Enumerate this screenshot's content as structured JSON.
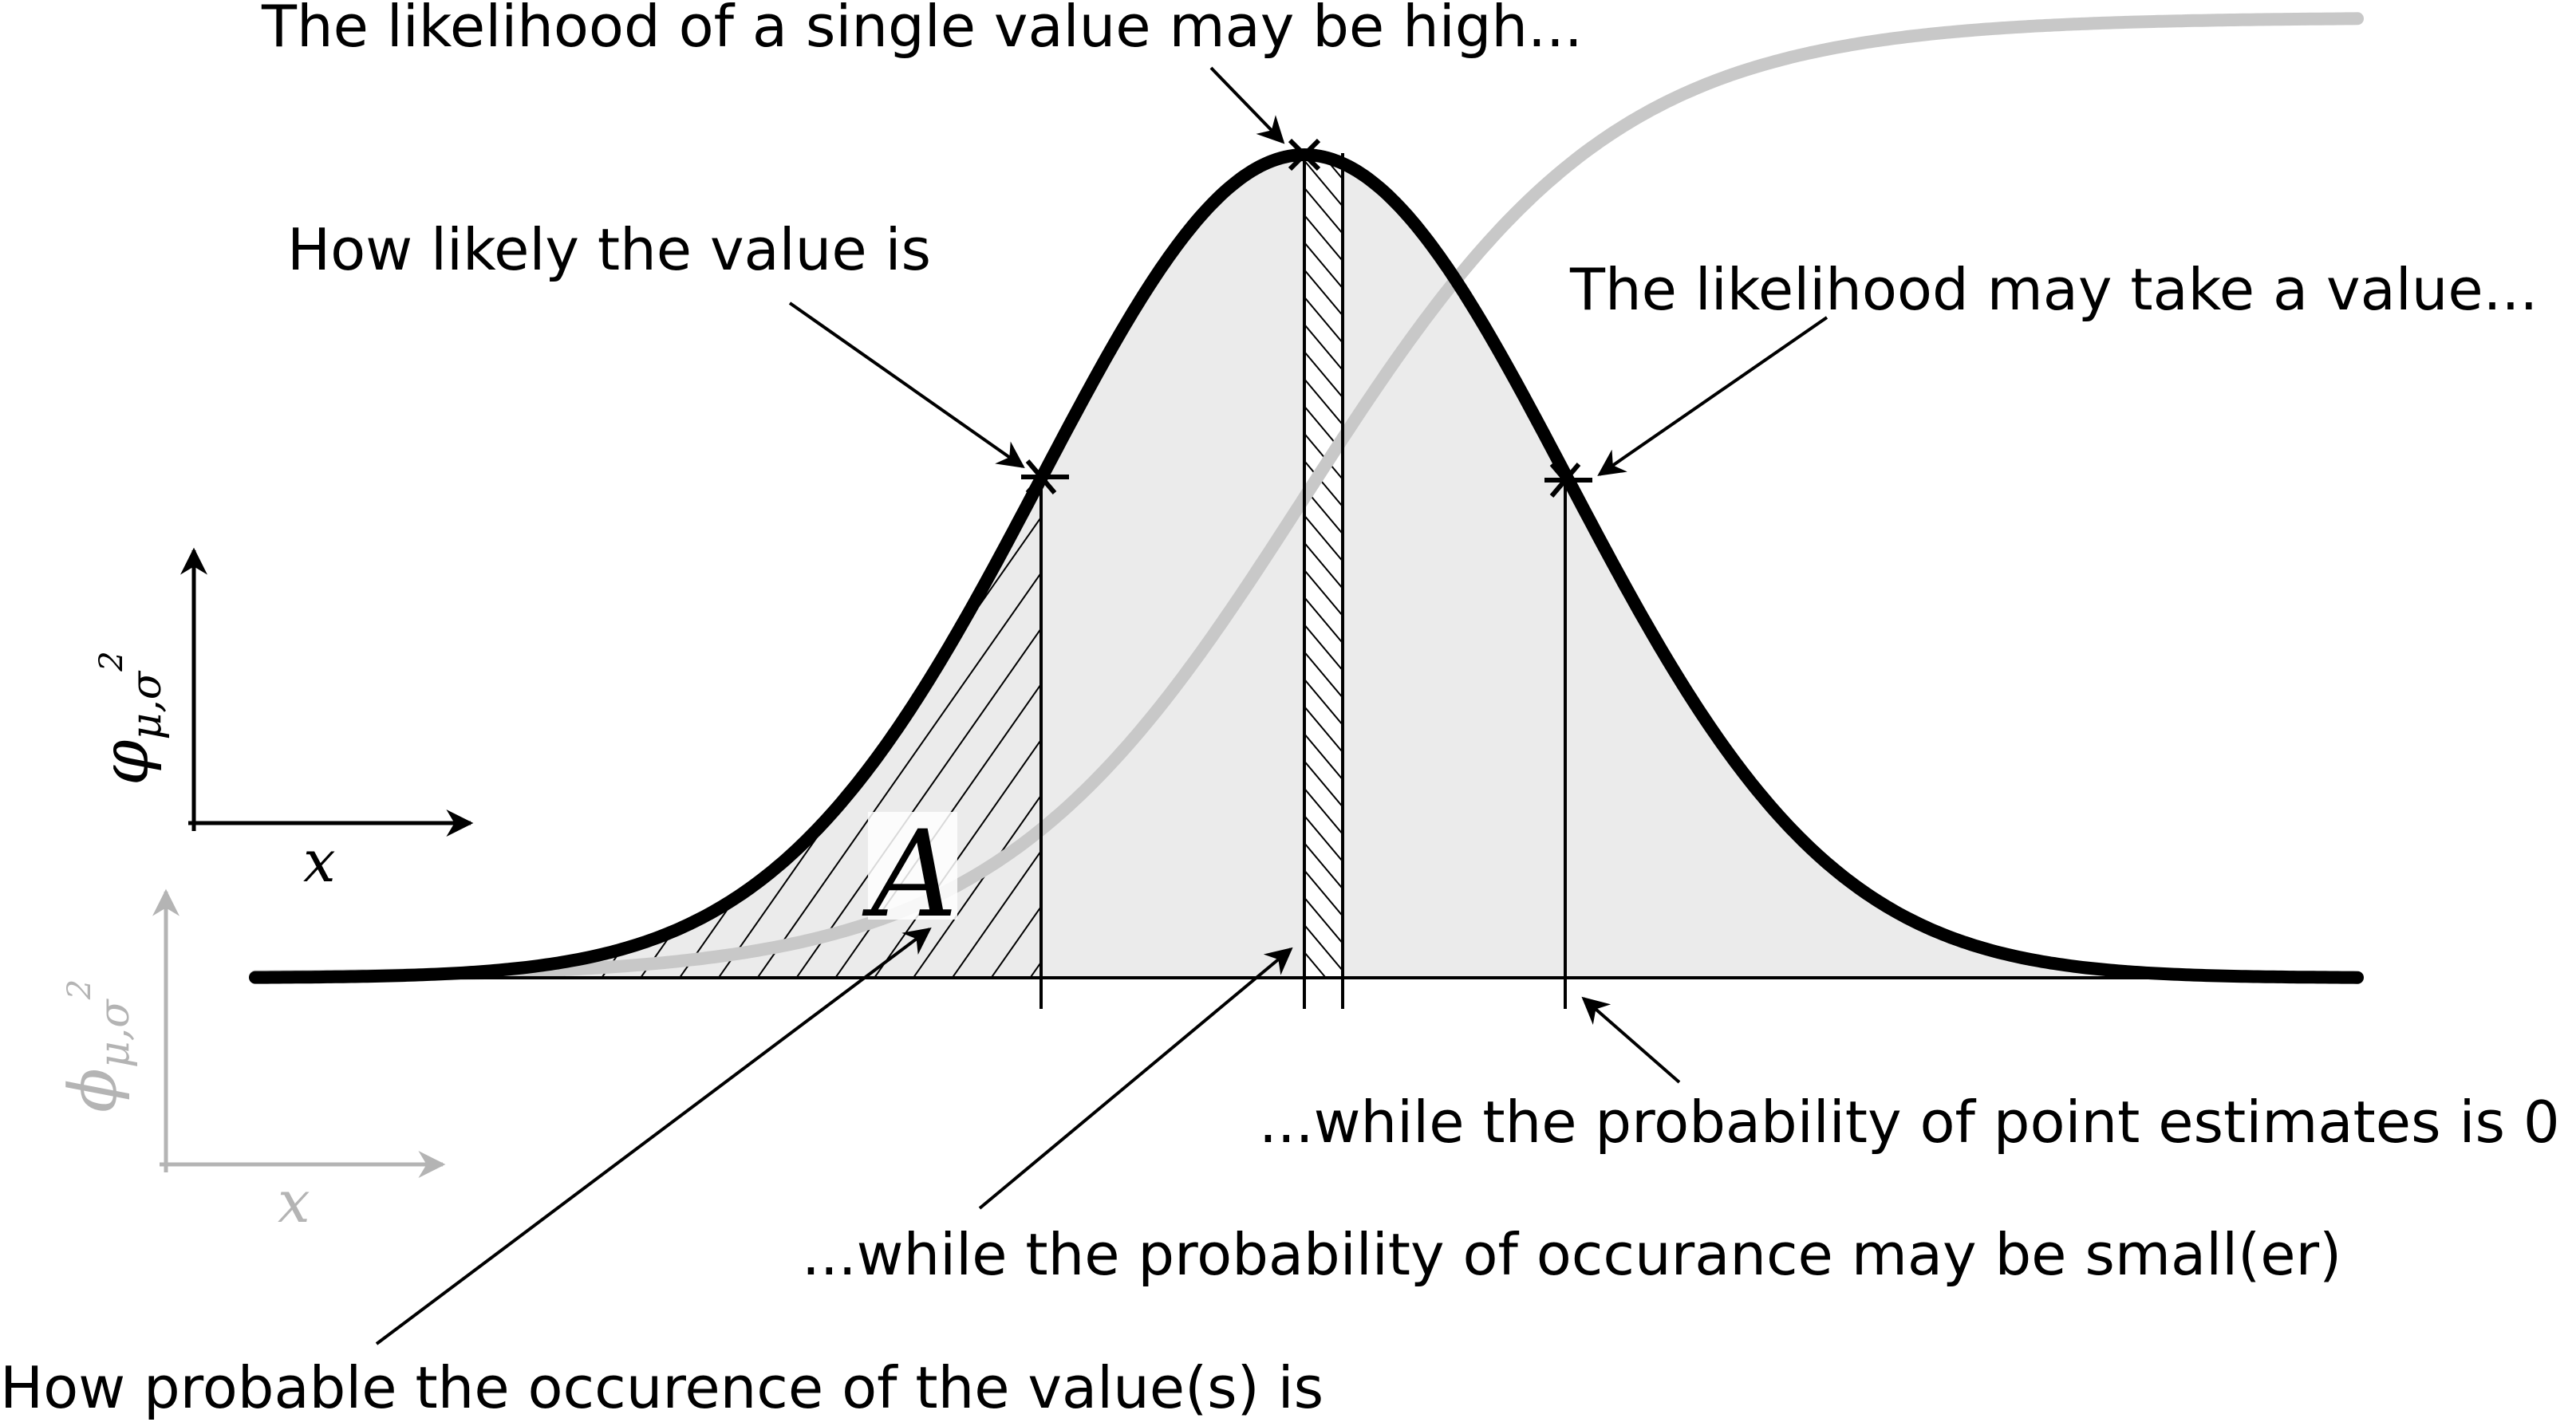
{
  "annotations": {
    "top": "The likelihood of a single value may be high...",
    "left": "How likely the value is",
    "right": "The likelihood may take a value...",
    "point_estimates": "...while the probability of point estimates is 0",
    "small": "...while the probability of occurance may be small(er)",
    "bottom": "How probable the occurence of the value(s) is"
  },
  "area_label": "A",
  "pdf_axes": {
    "y_symbol": "φ",
    "y_subscript": "μ,σ",
    "y_superscript": "2",
    "x_label": "x"
  },
  "cdf_axes": {
    "y_symbol": "ϕ",
    "y_subscript": "μ,σ",
    "y_superscript": "2",
    "x_label": "x"
  },
  "colors": {
    "pdf_curve": "#000000",
    "cdf_curve": "#c8c8c8",
    "fill": "#ebebeb",
    "cdf_axes": "#b4b4b4"
  }
}
